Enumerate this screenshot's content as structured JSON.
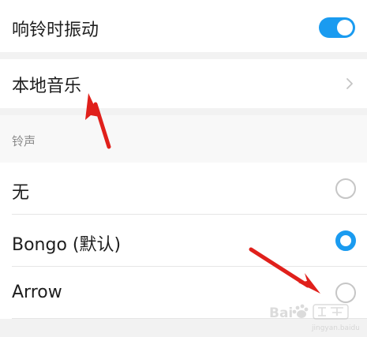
{
  "settings": {
    "vibrate_on_ring": {
      "label": "响铃时振动",
      "enabled": true
    },
    "local_music": {
      "label": "本地音乐",
      "icon": "chevron-right-icon"
    }
  },
  "ringtone_section": {
    "title": "铃声",
    "options": [
      {
        "label": "无",
        "selected": false
      },
      {
        "label": "Bongo (默认)",
        "selected": true
      },
      {
        "label": "Arrow",
        "selected": false
      }
    ]
  },
  "colors": {
    "accent": "#1a9bf0",
    "annotation_arrow": "#e0201b",
    "background": "#f2f2f2"
  },
  "watermark": {
    "logo": "Baidu 经验",
    "url": "jingyan.baidu.com"
  }
}
